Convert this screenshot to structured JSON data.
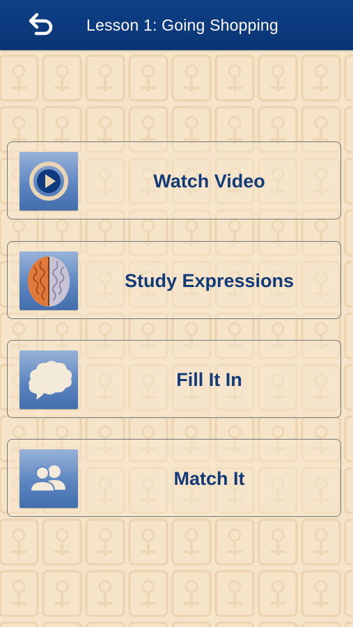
{
  "header": {
    "title": "Lesson 1: Going Shopping",
    "back_icon": "back-arrow-icon"
  },
  "menu": [
    {
      "label": "Watch Video",
      "icon": "play-icon"
    },
    {
      "label": "Study Expressions",
      "icon": "brain-icon"
    },
    {
      "label": "Fill It In",
      "icon": "speech-bubble-icon"
    },
    {
      "label": "Match It",
      "icon": "people-icon"
    }
  ],
  "colors": {
    "header_bg": "#0b3778",
    "label_text": "#123a79",
    "background": "#f5e3c8",
    "icon_tile": "#5d86c1"
  }
}
